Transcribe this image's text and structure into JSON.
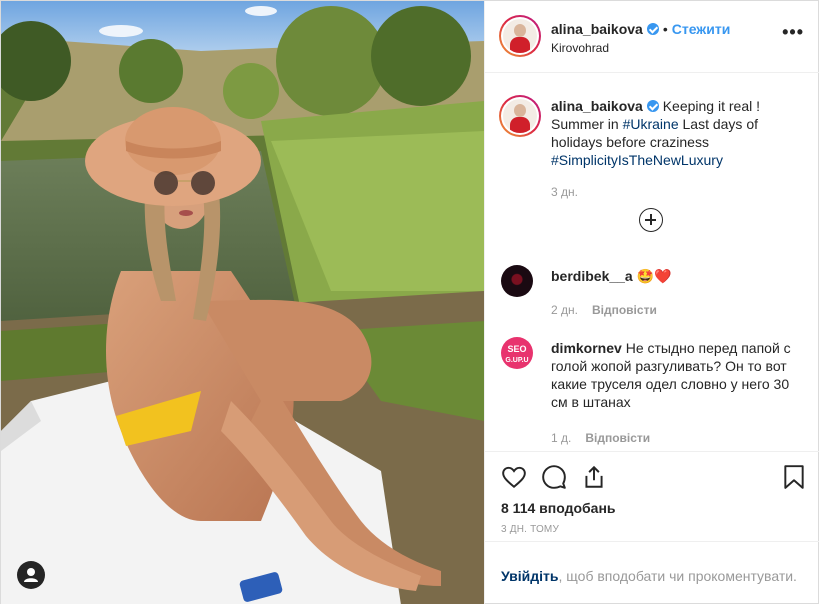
{
  "post": {
    "author": {
      "username": "alina_baikova",
      "follow_label": "Стежити",
      "location": "Kirovohrad",
      "more_label": "•••"
    },
    "caption": {
      "username": "alina_baikova",
      "text_before": " Keeping it real ! Summer in ",
      "tag_country": "#Ukraine",
      "text_after": " Last days of holidays before craziness ",
      "tag_luxury": "#SimplicityIsTheNewLuxury",
      "time": "3 дн."
    },
    "comments": [
      {
        "username": "berdibek__a",
        "text": "🤩❤️",
        "time": "2 дн.",
        "reply_label": "Відповісти"
      },
      {
        "username": "dimkornev",
        "avatar_text": "SEO",
        "avatar_subtext": "G.UP.U",
        "text": "Не стыдно перед папой с голой жопой разгуливать? Он то вот какие труселя одел словно у него 30 см в штанах",
        "time": "1 д.",
        "reply_label": "Відповісти"
      }
    ],
    "likes": "8 114 вподобань",
    "date": "3 ДН. ТОМУ",
    "login_prompt": {
      "login_label": "Увійдіть",
      "text": ", щоб вподобати чи прокоментувати."
    },
    "icons": {
      "like": "heart-icon",
      "comment": "comment-icon",
      "share": "share-icon",
      "save": "bookmark-icon",
      "load_more": "plus-circle-icon",
      "tagged_users": "user-icon"
    },
    "colors": {
      "link": "#3897f0",
      "hashtag": "#003569",
      "verified": "#3897f0",
      "muted": "#999999"
    }
  }
}
